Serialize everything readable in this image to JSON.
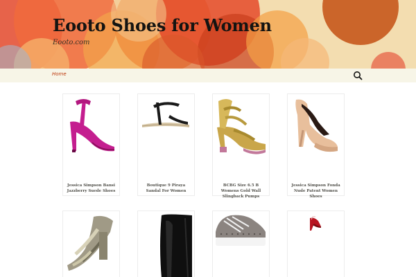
{
  "site": {
    "title": "Eooto Shoes for Women",
    "description": "Eooto.com"
  },
  "nav": {
    "home_label": "Home",
    "search_icon": "search-icon"
  },
  "colors": {
    "header_bg": "#f3ddb0",
    "nav_bg": "#f7f5e7",
    "link": "#bc360a",
    "title": "#141412"
  },
  "products": [
    {
      "name": "Jessica Simpson Bansi Jazzberry Suede Shoes",
      "image": "pink suede t-strap high heel"
    },
    {
      "name": "Boutique 9 Piraya Sandal For Women",
      "image": "black t-strap flat sandal"
    },
    {
      "name": "BCBG Size 6.5 B Womens Gold Wall Slingback Pumps",
      "image": "gold strappy platform sandal"
    },
    {
      "name": "Jessica Simpson Fonda Nude Patent Women Shoes",
      "image": "nude patent platform pump"
    },
    {
      "name": "",
      "image": "snakeskin strappy platform sandal"
    },
    {
      "name": "",
      "image": "black leather knee boot"
    },
    {
      "name": "",
      "image": "grey studded platform sneaker"
    },
    {
      "name": "",
      "image": "small red high heel"
    }
  ]
}
